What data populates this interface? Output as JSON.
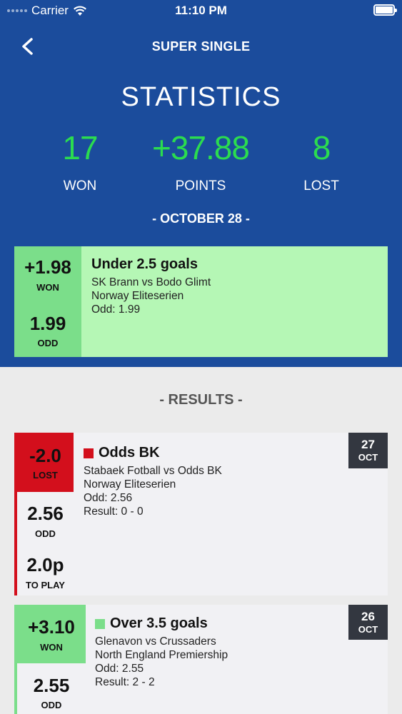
{
  "status_bar": {
    "carrier": "Carrier",
    "time": "11:10 PM"
  },
  "nav": {
    "title": "SUPER SINGLE"
  },
  "stats": {
    "title": "STATISTICS",
    "won_value": "17",
    "won_label": "WON",
    "points_value": "+37.88",
    "points_label": "POINTS",
    "lost_value": "8",
    "lost_label": "LOST"
  },
  "current_date": "- OCTOBER 28 -",
  "current_bet": {
    "result_value": "+1.98",
    "result_label": "WON",
    "odd_value": "1.99",
    "odd_label": "ODD",
    "title": "Under 2.5 goals",
    "match": "SK Brann vs Bodo Glimt",
    "league": "Norway Eliteserien",
    "odd_text": "Odd: 1.99"
  },
  "results": {
    "heading": "- RESULTS -",
    "items": [
      {
        "result_value": "-2.0",
        "result_label": "LOST",
        "odd_value": "2.56",
        "odd_label": "ODD",
        "stake_value": "2.0p",
        "stake_label": "TO PLAY",
        "title": "Odds BK",
        "match": "Stabaek Fotball vs Odds BK",
        "league": "Norway Eliteserien",
        "odd_text": "Odd: 2.56",
        "result_text": "Result: 0 - 0",
        "day": "27",
        "month": "OCT",
        "status_color": "#d30f1c"
      },
      {
        "result_value": "+3.10",
        "result_label": "WON",
        "odd_value": "2.55",
        "odd_label": "ODD",
        "title": "Over 3.5 goals",
        "match": "Glenavon vs Crussaders",
        "league": "North England Premiership",
        "odd_text": "Odd: 2.55",
        "result_text": "Result: 2 - 2",
        "day": "26",
        "month": "OCT",
        "status_color": "#7bde8a"
      }
    ]
  },
  "colors": {
    "header_bg": "#1b4c9c",
    "accent_green": "#2bdc4f",
    "won_green": "#7bde8a",
    "lost_red": "#d30f1c"
  }
}
